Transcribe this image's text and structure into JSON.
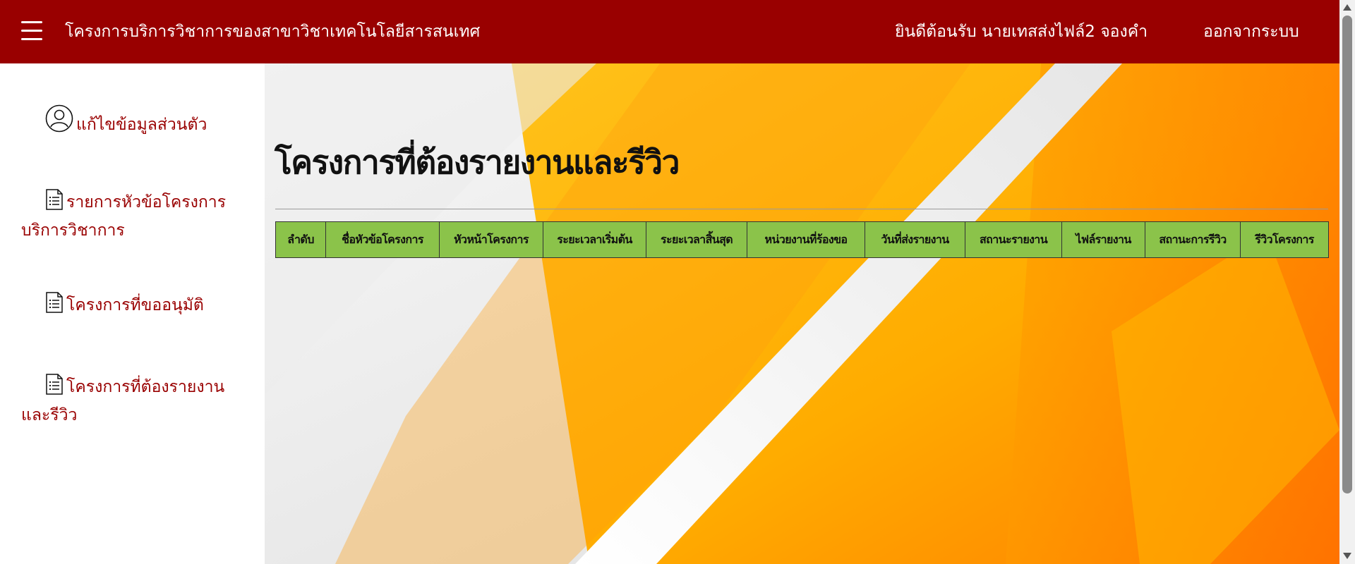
{
  "header": {
    "site_title": "โครงการบริการวิชาการของสาขาวิชาเทคโนโลยีสารสนเทศ",
    "welcome_text": "ยินดีต้อนรับ นายเทสส่งไฟล์2 จองคำ",
    "logout_label": "ออกจากระบบ"
  },
  "sidebar": {
    "items": [
      {
        "icon": "user-circle-icon",
        "label_line1": "แก้ไขข้อมูลส่วนตัว",
        "label_line2": ""
      },
      {
        "icon": "document-list-icon",
        "label_line1": "รายการหัวข้อโครงการ",
        "label_line2": "บริการวิชาการ"
      },
      {
        "icon": "document-list-icon",
        "label_line1": "โครงการที่ขออนุมัติ",
        "label_line2": ""
      },
      {
        "icon": "document-list-icon",
        "label_line1": "โครงการที่ต้องรายงาน",
        "label_line2": "และรีวิว"
      }
    ]
  },
  "main": {
    "page_title": "โครงการที่ต้องรายงานและรีวิว",
    "table": {
      "columns": [
        "ลำดับ",
        "ชื่อหัวข้อโครงการ",
        "หัวหน้าโครงการ",
        "ระยะเวลาเริ่มต้น",
        "ระยะเวลาสิ้นสุด",
        "หน่วยงานที่ร้องขอ",
        "วันที่ส่งรายงาน",
        "สถานะรายงาน",
        "ไฟล์รายงาน",
        "สถานะการรีวิว",
        "รีวิวโครงการ"
      ],
      "rows": []
    }
  },
  "colors": {
    "header_bg": "#990000",
    "sidebar_text": "#990000",
    "table_header_bg": "#8bc34a",
    "bg_orange": "#ffb300",
    "bg_deep_orange": "#ff7a00"
  }
}
